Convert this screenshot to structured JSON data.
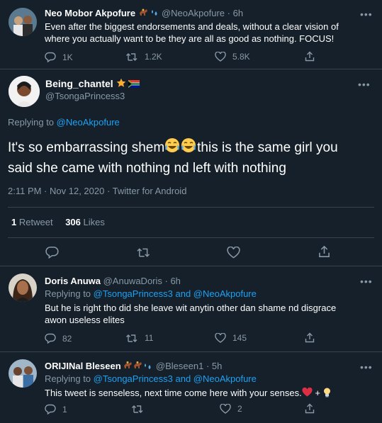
{
  "tweet1": {
    "name": "Neo Mobor Akpofure",
    "handle": "@NeoAkpofure",
    "time": "· 6h",
    "text_line1": "Even after the biggest endorsements and deals, without a clear vision of",
    "text_line2": "where you actually want to be they are all as good as nothing. FOCUS!",
    "replies": "1K",
    "retweets": "1.2K",
    "likes": "5.8K"
  },
  "main": {
    "name": "Being_chantel",
    "handle": "@TsongaPrincess3",
    "replying_prefix": "Replying to",
    "replying_to": "@NeoAkpofure",
    "text_part1": "It's so embarrassing shem",
    "text_part2": "this is the same girl you",
    "text_line2": "said she came with nothing nd  left with nothing",
    "meta": "2:11 PM · Nov 12, 2020 · Twitter for Android",
    "retweet_count": "1",
    "retweet_label": "Retweet",
    "like_count": "306",
    "like_label": "Likes"
  },
  "reply1": {
    "name": "Doris Anuwa",
    "handle": "@AnuwaDoris",
    "time": "· 6h",
    "replying_prefix": "Replying to",
    "replying_to": "@TsongaPrincess3 and @NeoAkpofure",
    "text_line1": "But he is right tho did she leave wit anytin other dan shame nd disgrace",
    "text_line2": "awon useless elites",
    "replies": "82",
    "retweets": "11",
    "likes": "145"
  },
  "reply2": {
    "name": "ORIJINal Bleseen",
    "handle": "@Bleseen1",
    "time": "· 5h",
    "replying_prefix": "Replying to",
    "replying_to": "@TsongaPrincess3 and @NeoAkpofure",
    "text": "This tweet is senseless, next time come here with your senses.",
    "plus": "+",
    "replies": "1",
    "likes": "2"
  },
  "colors": {
    "background": "#15202b",
    "muted": "#8899a6",
    "link": "#1da1f2",
    "divider": "#38444d"
  }
}
